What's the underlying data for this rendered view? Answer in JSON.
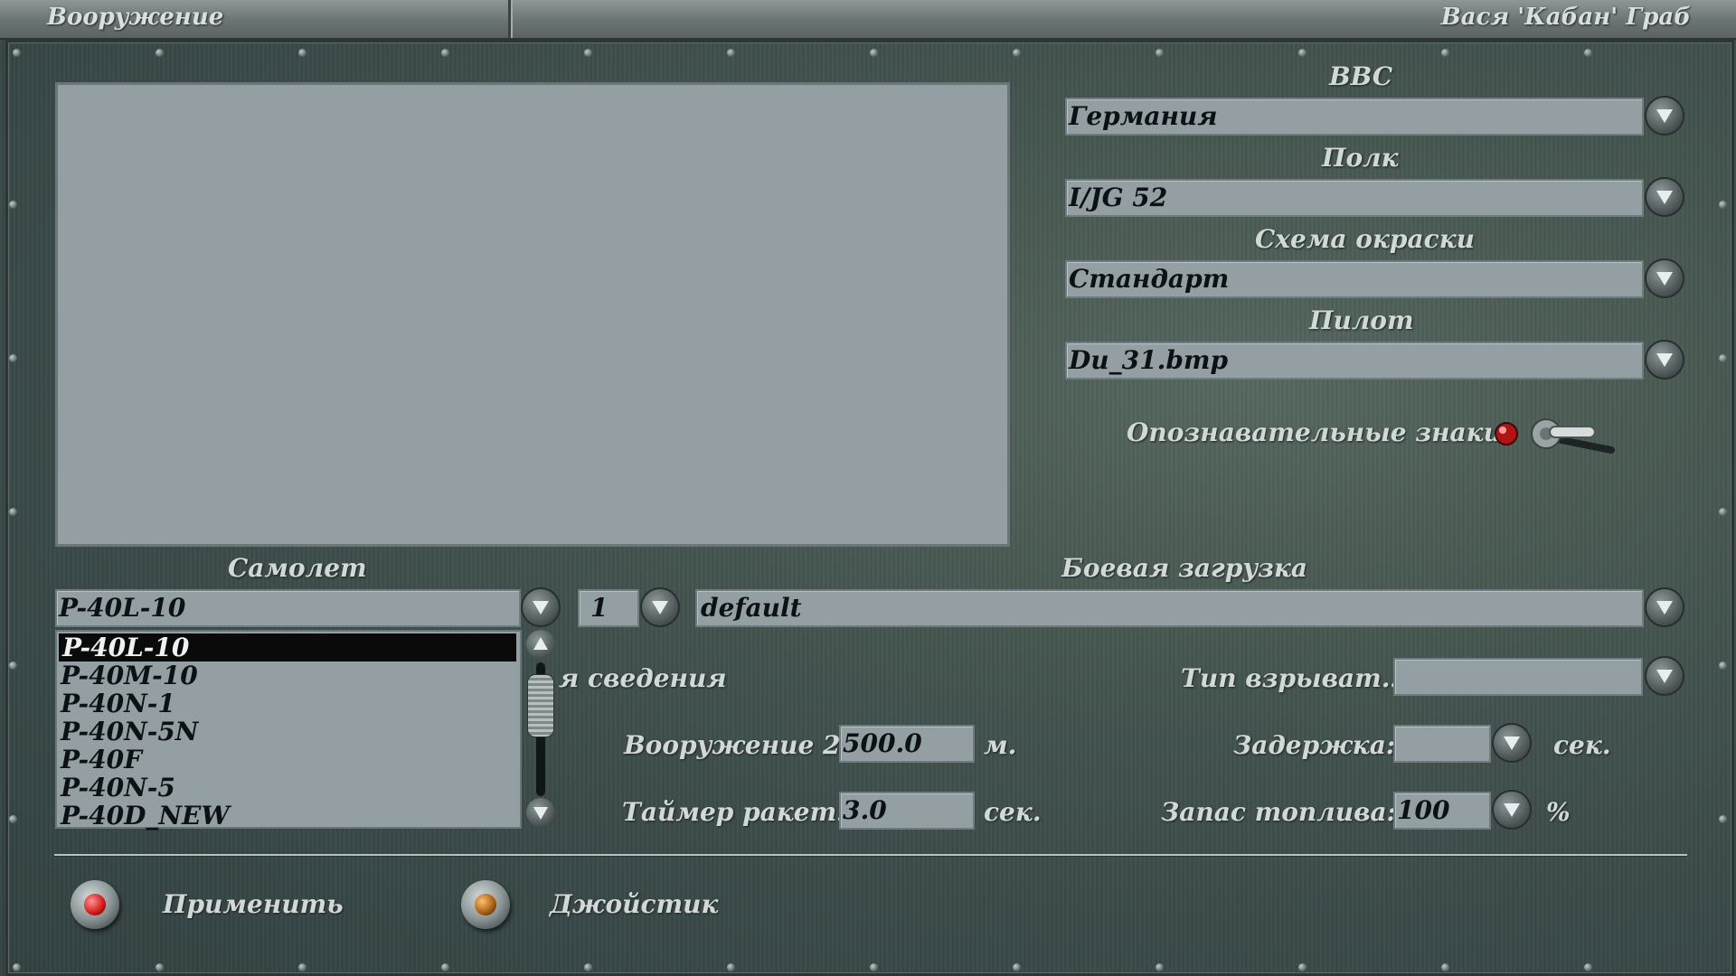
{
  "window": {
    "title_left": "Вооружение",
    "title_right": "Вася 'Кабан' Граб"
  },
  "right_panel": {
    "bbc_label": "BBC",
    "bbc_value": "Германия",
    "regiment_label": "Полк",
    "regiment_value": "I/JG 52",
    "scheme_label": "Схема окраски",
    "scheme_value": "Стандарт",
    "pilot_label": "Пилот",
    "pilot_value": "Du_31.bmp",
    "markings_label": "Опознавательные знаки:"
  },
  "aircraft": {
    "label": "Самолет",
    "value": "P-40L-10",
    "count": "1",
    "options": [
      "P-40L-10",
      "P-40M-10",
      "P-40N-1",
      "P-40N-5N",
      "P-40F",
      "P-40N-5",
      "P-40D_NEW"
    ],
    "selected_index": 0
  },
  "loadout": {
    "label": "Боевая загрузка",
    "value": "default"
  },
  "details": {
    "info_partial": "я сведения",
    "fuse_label": "Тип взрыват.:",
    "fuse_value": "",
    "armament2_label": "Вооружение 2:",
    "armament2_value": "500.0",
    "armament2_unit": "м.",
    "delay_label": "Задержка:",
    "delay_value": "",
    "delay_unit": "сек.",
    "rocket_timer_label": "Таймер ракет:",
    "rocket_timer_value": "3.0",
    "rocket_timer_unit": "сек.",
    "fuel_label": "Запас топлива:",
    "fuel_value": "100",
    "fuel_unit": "%"
  },
  "buttons": {
    "apply": "Применить",
    "joystick": "Джойстик"
  },
  "colors": {
    "field_bg": "#939fa3",
    "panel_bg": "#3c4c4c",
    "apply_lamp": "#d01818",
    "joystick_lamp": "#a25a10"
  }
}
